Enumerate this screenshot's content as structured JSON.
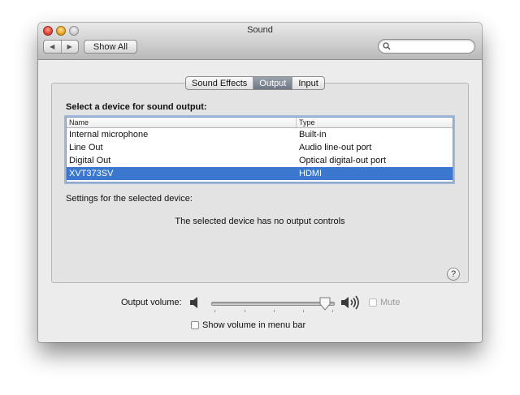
{
  "window": {
    "title": "Sound",
    "show_all_label": "Show All",
    "search_placeholder": ""
  },
  "tabs": [
    {
      "label": "Sound Effects",
      "active": false
    },
    {
      "label": "Output",
      "active": true
    },
    {
      "label": "Input",
      "active": false
    }
  ],
  "output": {
    "section_label": "Select a device for sound output:",
    "columns": [
      "Name",
      "Type"
    ],
    "devices": [
      {
        "name": "Internal microphone",
        "type": "Built-in",
        "selected": false
      },
      {
        "name": "Line Out",
        "type": "Audio line-out port",
        "selected": false
      },
      {
        "name": "Digital Out",
        "type": "Optical digital-out port",
        "selected": false
      },
      {
        "name": "XVT373SV",
        "type": "HDMI",
        "selected": true
      }
    ],
    "settings_label": "Settings for the selected device:",
    "no_controls_text": "The selected device has no output controls",
    "help_label": "?"
  },
  "volume": {
    "label": "Output volume:",
    "level": 0.93,
    "mute_label": "Mute",
    "mute_enabled": false,
    "show_in_menu_bar_label": "Show volume in menu bar",
    "show_in_menu_bar_checked": false
  },
  "colors": {
    "selection": "#3b77cf",
    "active_tab": "#7d8792"
  }
}
